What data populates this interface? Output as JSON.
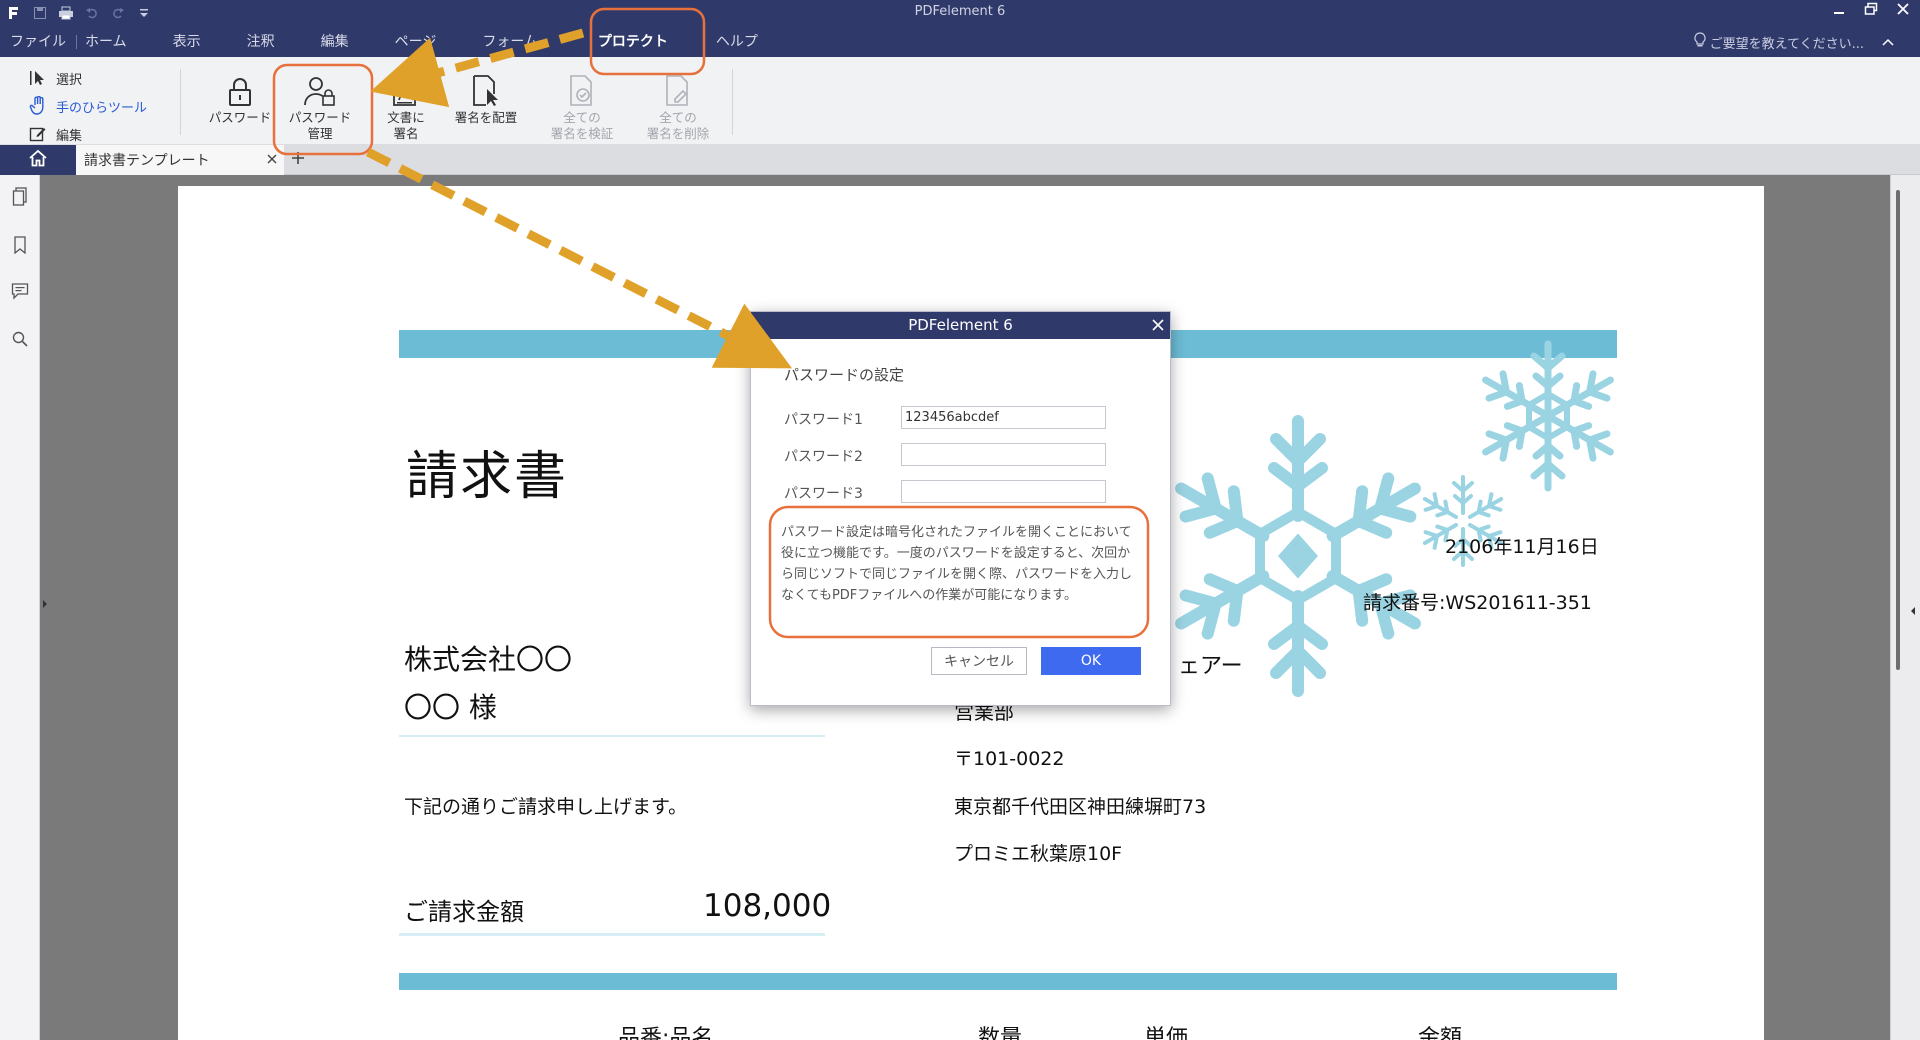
{
  "window": {
    "title": "PDFelement 6"
  },
  "menu": {
    "items": [
      "ファイル",
      "ホーム",
      "表示",
      "注釈",
      "編集",
      "ページ",
      "フォーム",
      "プロテクト",
      "ヘルプ"
    ],
    "help_hint": "ご要望を教えてください..."
  },
  "ribbon": {
    "mini_tools": [
      "選択",
      "手のひらツール",
      "編集"
    ],
    "buttons": [
      {
        "line1": "パスワード",
        "line2": ""
      },
      {
        "line1": "パスワード",
        "line2": "管理"
      },
      {
        "line1": "文書に",
        "line2": "署名"
      },
      {
        "line1": "署名を配置",
        "line2": ""
      },
      {
        "line1": "全ての",
        "line2": "署名を検証"
      },
      {
        "line1": "全ての",
        "line2": "署名を削除"
      }
    ]
  },
  "tabs": {
    "document": "請求書テンプレート"
  },
  "document": {
    "title": "請求書",
    "date": "2106年11月16日",
    "invoice_no": "請求番号:WS201611-351",
    "recipient_company": "株式会社〇〇",
    "recipient_name": "〇〇 様",
    "sender_partial": "ェアー",
    "dept": "営業部",
    "postal": "〒101-0022",
    "address1": "東京都千代田区神田練塀町73",
    "address2": "プロミエ秋葉原10F",
    "greeting": "下記の通りご請求申し上げます。",
    "amount_label": "ご請求金額",
    "amount_value": "108,000",
    "col1": "品番:品名",
    "col2": "数量",
    "col3": "単価",
    "col4": "金額"
  },
  "dialog": {
    "title": "PDFelement 6",
    "subtitle": "パスワードの設定",
    "label1": "パスワード1",
    "label2": "パスワード2",
    "label3": "パスワード3",
    "value1": "123456abcdef",
    "value2": "",
    "value3": "",
    "description": "パスワード設定は暗号化されたファイルを開くことにおいて役に立つ機能です。一度のパスワードを設定すると、次回から同じソフトで同じファイルを開く際、パスワードを入力しなくてもPDFファイルへの作業が可能になります。",
    "cancel": "キャンセル",
    "ok": "OK"
  },
  "colors": {
    "titlebar": "#2f3a6b",
    "band": "#6dbcd6",
    "snowflake": "#9ad4e3",
    "ok_button": "#3e6af0",
    "highlight": "#e8703c",
    "arrow": "#e0a12a"
  }
}
